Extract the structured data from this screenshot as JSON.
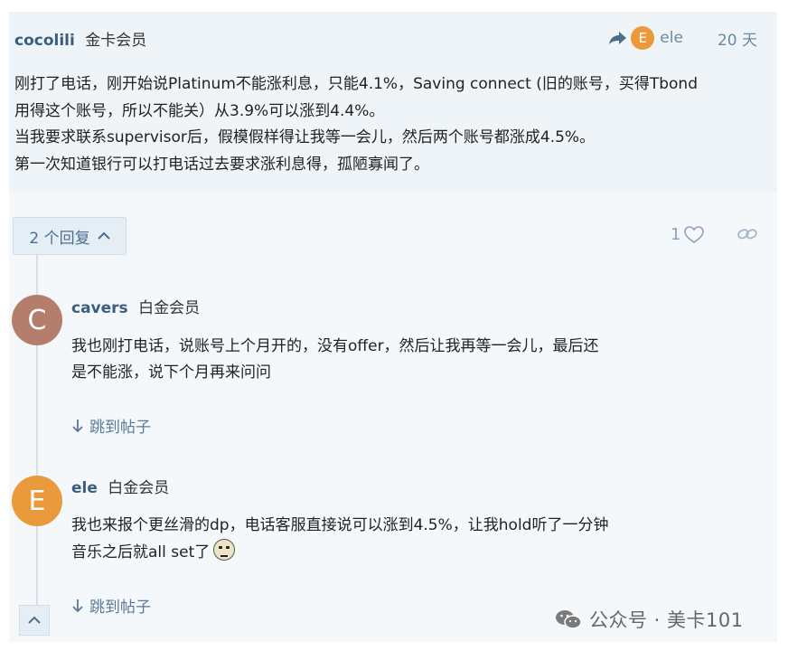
{
  "post": {
    "username": "cocolili",
    "badge": "金卡会员",
    "reply_to": {
      "avatar_letter": "E",
      "user": "ele",
      "avatar_color": "#ea9a3a"
    },
    "time": "20 天",
    "body": [
      "刚打了电话，刚开始说Platinum不能涨利息，只能4.1%，Saving connect (旧的账号，买得Tbond",
      "用得这个账号，所以不能关）从3.9%可以涨到4.4%。",
      "当我要求联系supervisor后，假模假样得让我等一会儿，然后两个账号都涨成4.5%。",
      "第一次知道银行可以打电话过去要求涨利息得，孤陋寡闻了。"
    ],
    "replies_toggle": "2 个回复",
    "likes": "1"
  },
  "replies": [
    {
      "avatar_letter": "C",
      "avatar_color": "#b57e6c",
      "username": "cavers",
      "badge": "白金会员",
      "body": [
        "我也刚打电话，说账号上个月开的，没有offer，然后让我再等一会儿，最后还",
        "是不能涨，说下个月再来问问"
      ],
      "jump": "跳到帖子"
    },
    {
      "avatar_letter": "E",
      "avatar_color": "#ea9a3a",
      "username": "ele",
      "badge": "白金会员",
      "body": [
        "我也来报个更丝滑的dp，电话客服直接说可以涨到4.5%，让我hold听了一分钟",
        "音乐之后就all set了"
      ],
      "jump": "跳到帖子"
    }
  ],
  "watermark": "公众号 · 美卡101",
  "colors": {
    "username": "#3a5f7e",
    "link": "#5a7a96",
    "post_bg": "#eef4f8"
  }
}
